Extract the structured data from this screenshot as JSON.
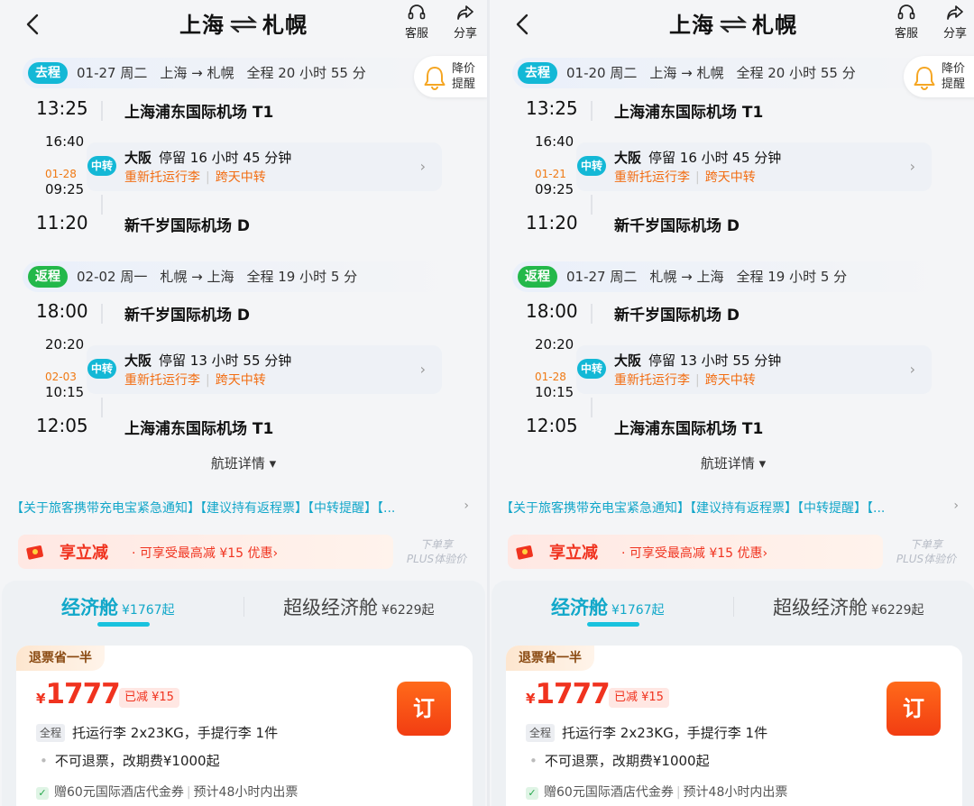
{
  "panes": [
    {
      "header": {
        "origin": "上海",
        "destination": "札幌",
        "service_label": "客服",
        "share_label": "分享"
      },
      "alert": {
        "line1": "降价",
        "line2": "提醒"
      },
      "outbound": {
        "tag": "去程",
        "date": "01-27 周二",
        "route": "上海 → 札幌",
        "duration": "全程 20 小时 55 分",
        "dep_time": "13:25",
        "dep_airport": "上海浦东国际机场 T1",
        "leg1_arr": "16:40",
        "next_day": "01-28",
        "leg2_dep": "09:25",
        "transfer_tag": "中转",
        "transfer_city": "大阪",
        "transfer_stay": "停留 16 小时 45 分钟",
        "warn1": "重新托运行李",
        "warn2": "跨天中转",
        "arr_time": "11:20",
        "arr_airport": "新千岁国际机场 D"
      },
      "return": {
        "tag": "返程",
        "date": "02-02 周一",
        "route": "札幌 → 上海",
        "duration": "全程 19 小时 5 分",
        "dep_time": "18:00",
        "dep_airport": "新千岁国际机场 D",
        "leg1_arr": "20:20",
        "next_day": "02-03",
        "leg2_dep": "10:15",
        "transfer_tag": "中转",
        "transfer_city": "大阪",
        "transfer_stay": "停留 13 小时 55 分钟",
        "warn1": "重新托运行李",
        "warn2": "跨天中转",
        "arr_time": "12:05",
        "arr_airport": "上海浦东国际机场 T1"
      },
      "details_label": "航班详情 ▾",
      "notice": "【关于旅客携带充电宝紧急通知】【建议持有返程票】【中转提醒】【...",
      "promo": {
        "title": "享立减",
        "text": "· 可享受最高减 ¥15 优惠›",
        "plus1": "下单享",
        "plus2": "PLUS体验价"
      },
      "cabins": {
        "eco_name": "经济舱",
        "eco_price": "¥1767起",
        "prem_name": "超级经济舱",
        "prem_price": "¥6229起"
      },
      "offer": {
        "refund_tag": "退票省一半",
        "currency": "¥",
        "price": "1777",
        "discount": "已减 ¥15",
        "book_label": "订",
        "bag_tag": "全程",
        "baggage": "托运行李 2x23KG，手提行李 1件",
        "rule": "不可退票，改期费¥1000起",
        "gift": "赠60元国际酒店代金券",
        "eta": "预计48小时内出票"
      }
    },
    {
      "header": {
        "origin": "上海",
        "destination": "札幌",
        "service_label": "客服",
        "share_label": "分享"
      },
      "alert": {
        "line1": "降价",
        "line2": "提醒"
      },
      "outbound": {
        "tag": "去程",
        "date": "01-20 周二",
        "route": "上海 → 札幌",
        "duration": "全程 20 小时 55 分",
        "dep_time": "13:25",
        "dep_airport": "上海浦东国际机场 T1",
        "leg1_arr": "16:40",
        "next_day": "01-21",
        "leg2_dep": "09:25",
        "transfer_tag": "中转",
        "transfer_city": "大阪",
        "transfer_stay": "停留 16 小时 45 分钟",
        "warn1": "重新托运行李",
        "warn2": "跨天中转",
        "arr_time": "11:20",
        "arr_airport": "新千岁国际机场 D"
      },
      "return": {
        "tag": "返程",
        "date": "01-27 周二",
        "route": "札幌 → 上海",
        "duration": "全程 19 小时 5 分",
        "dep_time": "18:00",
        "dep_airport": "新千岁国际机场 D",
        "leg1_arr": "20:20",
        "next_day": "01-28",
        "leg2_dep": "10:15",
        "transfer_tag": "中转",
        "transfer_city": "大阪",
        "transfer_stay": "停留 13 小时 55 分钟",
        "warn1": "重新托运行李",
        "warn2": "跨天中转",
        "arr_time": "12:05",
        "arr_airport": "上海浦东国际机场 T1"
      },
      "details_label": "航班详情 ▾",
      "notice": "【关于旅客携带充电宝紧急通知】【建议持有返程票】【中转提醒】【...",
      "promo": {
        "title": "享立减",
        "text": "· 可享受最高减 ¥15 优惠›",
        "plus1": "下单享",
        "plus2": "PLUS体验价"
      },
      "cabins": {
        "eco_name": "经济舱",
        "eco_price": "¥1767起",
        "prem_name": "超级经济舱",
        "prem_price": "¥6229起"
      },
      "offer": {
        "refund_tag": "退票省一半",
        "currency": "¥",
        "price": "1777",
        "discount": "已减 ¥15",
        "book_label": "订",
        "bag_tag": "全程",
        "baggage": "托运行李 2x23KG，手提行李 1件",
        "rule": "不可退票，改期费¥1000起",
        "gift": "赠60元国际酒店代金券",
        "eta": "预计48小时内出票"
      }
    }
  ],
  "colors": {
    "accent": "#13b8d6",
    "return_green": "#23b84a",
    "price_red": "#f0331f",
    "warn_orange": "#f26d12"
  },
  "icons": [
    "back-arrow-icon",
    "swap-arrows-icon",
    "headset-icon",
    "share-icon",
    "bell-icon",
    "chevron-right-icon",
    "coupon-icon",
    "check-icon"
  ]
}
